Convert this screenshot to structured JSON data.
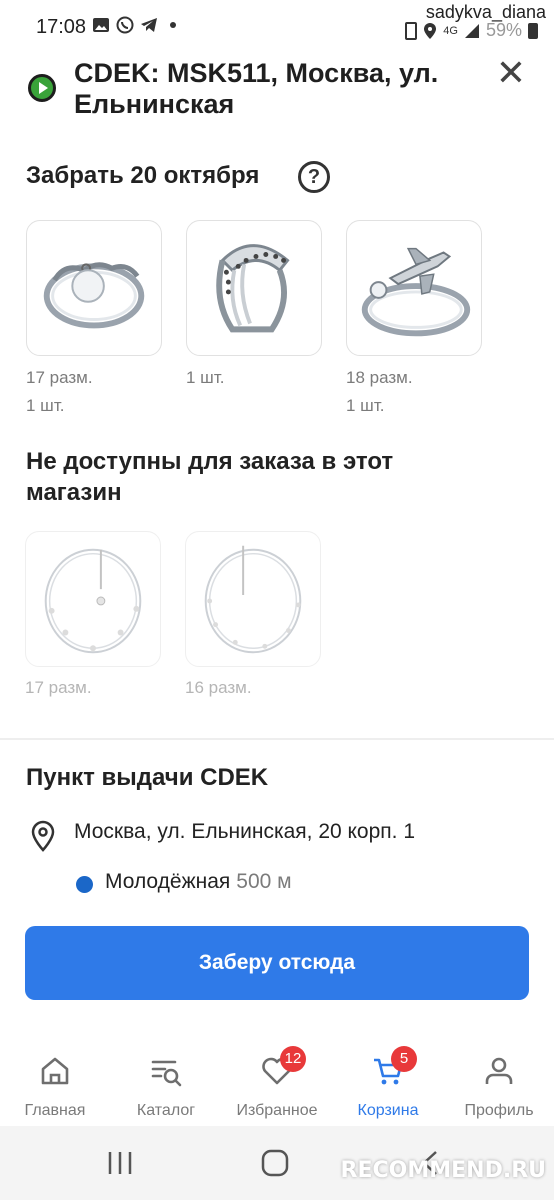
{
  "status_bar": {
    "time": "17:08",
    "battery": "59%",
    "username_watermark": "sadykva_diana",
    "icons": [
      "gallery-icon",
      "whatsapp-icon",
      "telegram-icon",
      "dot-icon",
      "battery-saver-icon",
      "location-icon",
      "network-icon",
      "signal-icon",
      "battery-icon"
    ]
  },
  "header": {
    "title": "CDEK:  MSK511, Москва, ул. Ельнинская",
    "close_icon": "close-icon",
    "store_status_color": "#3aa33a"
  },
  "pickup_section": {
    "title": "Забрать 20 октября",
    "help_label": "?",
    "products": [
      {
        "name": "ring-chain-coin",
        "size": "17 разм.",
        "qty": "1 шт."
      },
      {
        "name": "cuff-ring-stones",
        "size": "",
        "qty": "1 шт."
      },
      {
        "name": "ring-airplane",
        "size": "18 разм.",
        "qty": "1 шт."
      }
    ]
  },
  "unavailable_section": {
    "title": "Не доступны для заказа в этот магазин",
    "products": [
      {
        "name": "bracelet-1",
        "size": "17 разм."
      },
      {
        "name": "bracelet-2",
        "size": "16 разм."
      }
    ]
  },
  "pickup_point": {
    "title": "Пункт выдачи CDEK",
    "address": "Москва, ул. Ельнинская, 20 корп. 1",
    "metro_name": "Молодёжная",
    "metro_distance": "500 м",
    "metro_color": "#1b67c8"
  },
  "cta": {
    "label": "Заберу отсюда",
    "color": "#2f7ae8"
  },
  "bottom_nav": {
    "items": [
      {
        "label": "Главная",
        "icon": "home-icon"
      },
      {
        "label": "Каталог",
        "icon": "catalog-search-icon"
      },
      {
        "label": "Избранное",
        "icon": "heart-icon",
        "badge": "12"
      },
      {
        "label": "Корзина",
        "icon": "cart-icon",
        "badge": "5",
        "active": true
      },
      {
        "label": "Профиль",
        "icon": "profile-icon"
      }
    ]
  },
  "watermark": "RECOMMEND.RU"
}
